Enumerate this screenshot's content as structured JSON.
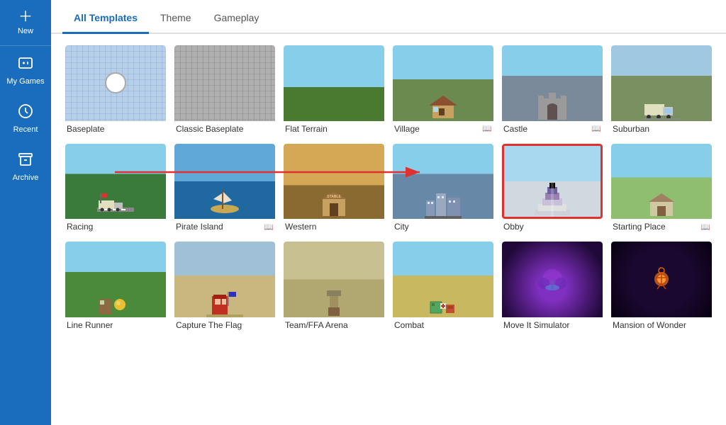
{
  "sidebar": {
    "items": [
      {
        "id": "new",
        "label": "New",
        "icon": "+"
      },
      {
        "id": "my-games",
        "label": "My Games",
        "icon": "🎮"
      },
      {
        "id": "recent",
        "label": "Recent",
        "icon": "🕐"
      },
      {
        "id": "archive",
        "label": "Archive",
        "icon": "🗃"
      }
    ]
  },
  "tabs": [
    {
      "id": "all-templates",
      "label": "All Templates",
      "active": true
    },
    {
      "id": "theme",
      "label": "Theme",
      "active": false
    },
    {
      "id": "gameplay",
      "label": "Gameplay",
      "active": false
    }
  ],
  "templates": [
    {
      "id": "baseplate",
      "label": "Baseplate",
      "book": false,
      "selected": false,
      "row": 0
    },
    {
      "id": "classic-baseplate",
      "label": "Classic Baseplate",
      "book": false,
      "selected": false,
      "row": 0
    },
    {
      "id": "flat-terrain",
      "label": "Flat Terrain",
      "book": false,
      "selected": false,
      "row": 0
    },
    {
      "id": "village",
      "label": "Village",
      "book": true,
      "selected": false,
      "row": 0
    },
    {
      "id": "castle",
      "label": "Castle",
      "book": true,
      "selected": false,
      "row": 0
    },
    {
      "id": "suburban",
      "label": "Suburban",
      "book": false,
      "selected": false,
      "row": 0
    },
    {
      "id": "racing",
      "label": "Racing",
      "book": false,
      "selected": false,
      "row": 1
    },
    {
      "id": "pirate-island",
      "label": "Pirate Island",
      "book": true,
      "selected": false,
      "row": 1
    },
    {
      "id": "western",
      "label": "Western",
      "book": false,
      "selected": false,
      "row": 1
    },
    {
      "id": "city",
      "label": "City",
      "book": false,
      "selected": false,
      "row": 1
    },
    {
      "id": "obby",
      "label": "Obby",
      "book": false,
      "selected": true,
      "row": 1
    },
    {
      "id": "starting-place",
      "label": "Starting Place",
      "book": true,
      "selected": false,
      "row": 1
    },
    {
      "id": "line-runner",
      "label": "Line Runner",
      "book": false,
      "selected": false,
      "row": 2
    },
    {
      "id": "capture-the-flag",
      "label": "Capture The Flag",
      "book": false,
      "selected": false,
      "row": 2
    },
    {
      "id": "team-ffa-arena",
      "label": "Team/FFA Arena",
      "book": false,
      "selected": false,
      "row": 2
    },
    {
      "id": "combat",
      "label": "Combat",
      "book": false,
      "selected": false,
      "row": 2
    },
    {
      "id": "move-it-simulator",
      "label": "Move It Simulator",
      "book": false,
      "selected": false,
      "row": 2
    },
    {
      "id": "mansion-of-wonder",
      "label": "Mansion of Wonder",
      "book": false,
      "selected": false,
      "row": 2
    }
  ],
  "arrow": {
    "visible": true
  }
}
